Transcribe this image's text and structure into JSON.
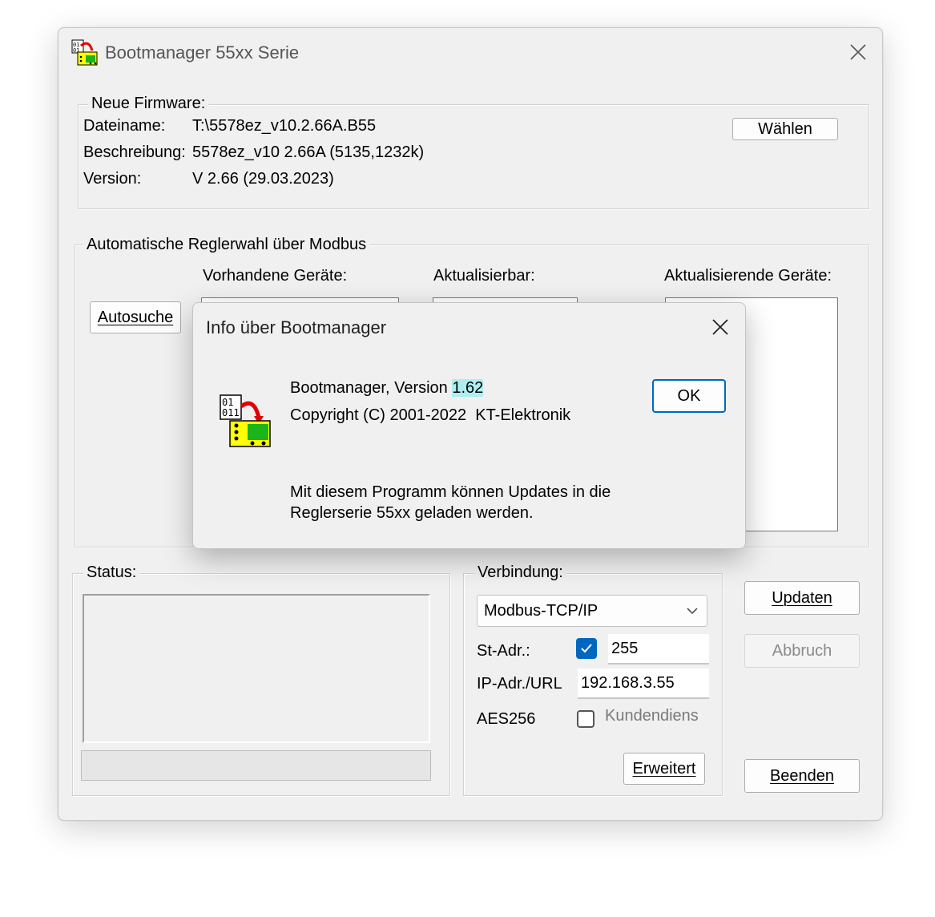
{
  "window": {
    "title": "Bootmanager 55xx Serie",
    "close_icon": "close-icon"
  },
  "firmware": {
    "group_title": "Neue Firmware:",
    "filename_label": "Dateiname:",
    "filename_value": "T:\\5578ez_v10.2.66A.B55",
    "description_label": "Beschreibung:",
    "description_value": "5578ez_v10 2.66A (5135,1232k)",
    "version_label": "Version:",
    "version_value": "V 2.66 (29.03.2023)",
    "choose_button": "Wählen"
  },
  "auto_select": {
    "group_title": "Automatische Reglerwahl über Modbus",
    "autosearch_button": "Autosuche",
    "existing_label": "Vorhandene Geräte:",
    "updatable_label": "Aktualisierbar:",
    "to_update_label": "Aktualisierende Geräte:"
  },
  "status": {
    "group_title": "Status:"
  },
  "connection": {
    "group_title": "Verbindung:",
    "protocol_selected": "Modbus-TCP/IP",
    "station_label": "St-Adr.:",
    "station_checked": true,
    "station_value": "255",
    "ip_label": "IP-Adr./URL",
    "ip_value": "192.168.3.55",
    "aes_label": "AES256",
    "aes_checked": false,
    "aes_option_label": "Kundendiens",
    "advanced_button": "Erweitert"
  },
  "actions": {
    "update_button": "Updaten",
    "abort_button": "Abbruch",
    "exit_button": "Beenden"
  },
  "about_dialog": {
    "title": "Info über Bootmanager",
    "version_prefix": "Bootmanager, Version ",
    "version_number": "1.62",
    "copyright": "Copyright (C) 2001-2022  KT-Elektronik",
    "description_line1": "Mit diesem Programm können Updates in die",
    "description_line2": "Reglerserie 55xx geladen werden.",
    "ok_button": "OK"
  },
  "colors": {
    "accent": "#0067c0",
    "highlight": "#aeeef0"
  }
}
